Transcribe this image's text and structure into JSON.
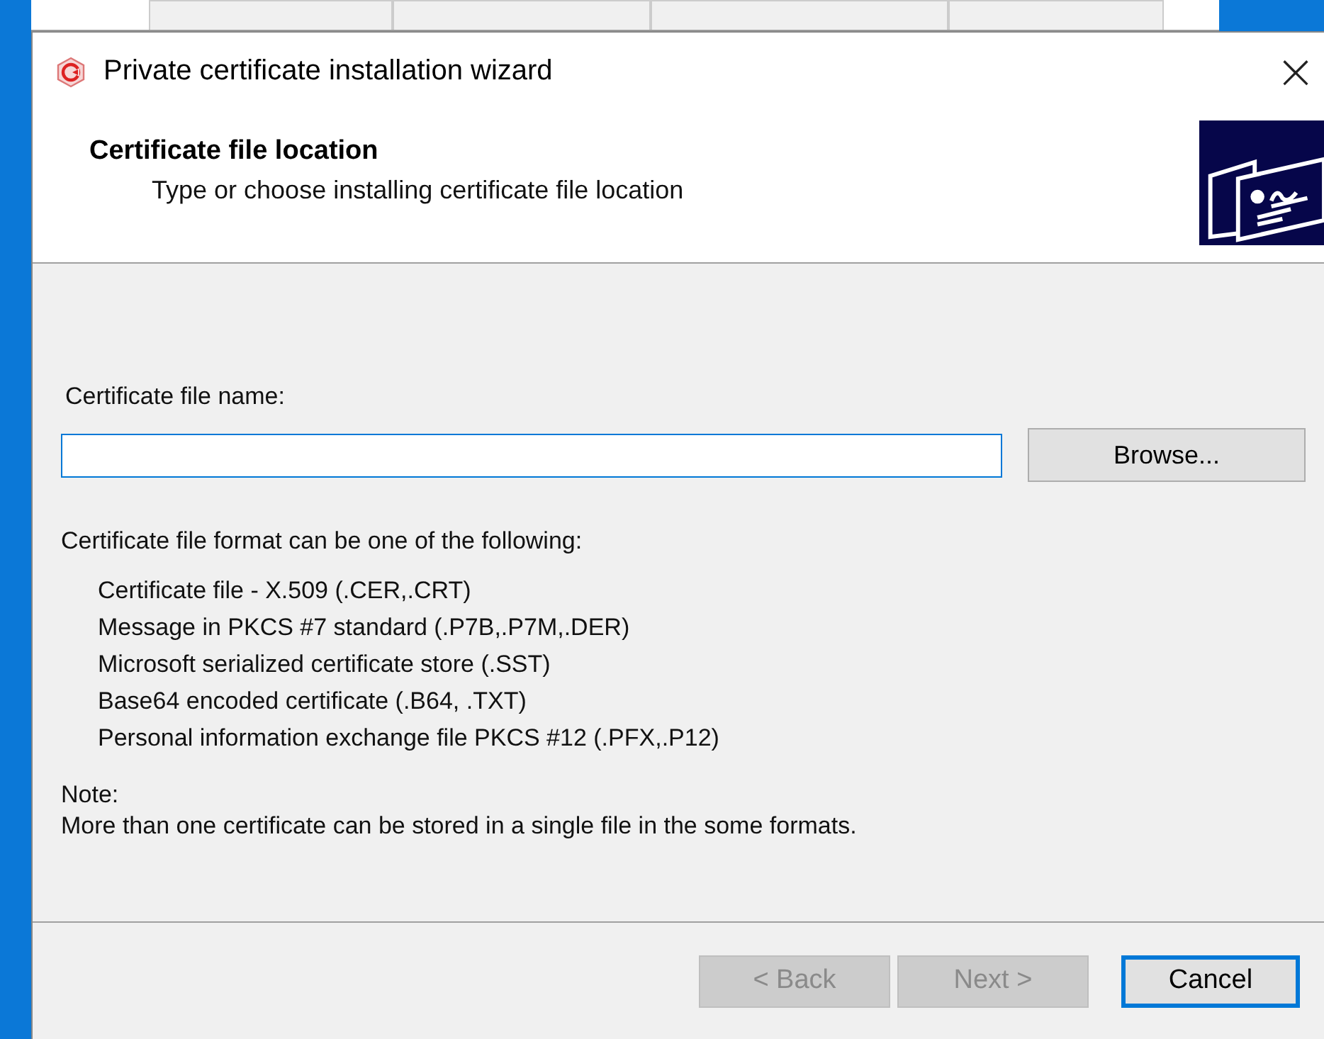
{
  "window": {
    "title": "Private certificate installation wizard",
    "close": "×"
  },
  "background_tabs": [
    {
      "kind": "tab"
    },
    {
      "kind": "tab"
    },
    {
      "kind": "tab"
    },
    {
      "kind": "tab"
    }
  ],
  "header": {
    "title": "Certificate file location",
    "subtitle": "Type or choose installing certificate file location"
  },
  "file_field": {
    "label": "Certificate file name:",
    "focused": true
  },
  "browse_button": "Browse...",
  "formats_intro": "Certificate file format can be one of the following:",
  "formats": [
    "Certificate file - X.509 (.CER,.CRT)",
    "Message in PKCS #7 standard (.P7B,.P7M,.DER)",
    "Microsoft serialized  certificate store (.SST)",
    "Base64 encoded certificate (.B64, .TXT)",
    "Personal information exchange file PKCS #12 (.PFX,.P12)"
  ],
  "note_label": "Note:",
  "note": "More than one certificate can be stored in a single file in the some formats.",
  "buttons": [
    {
      "label": "< Back",
      "disabled": true,
      "default": false
    },
    {
      "label": "Next >",
      "disabled": true,
      "default": false
    },
    {
      "label": "Cancel",
      "disabled": false,
      "default": true
    }
  ]
}
